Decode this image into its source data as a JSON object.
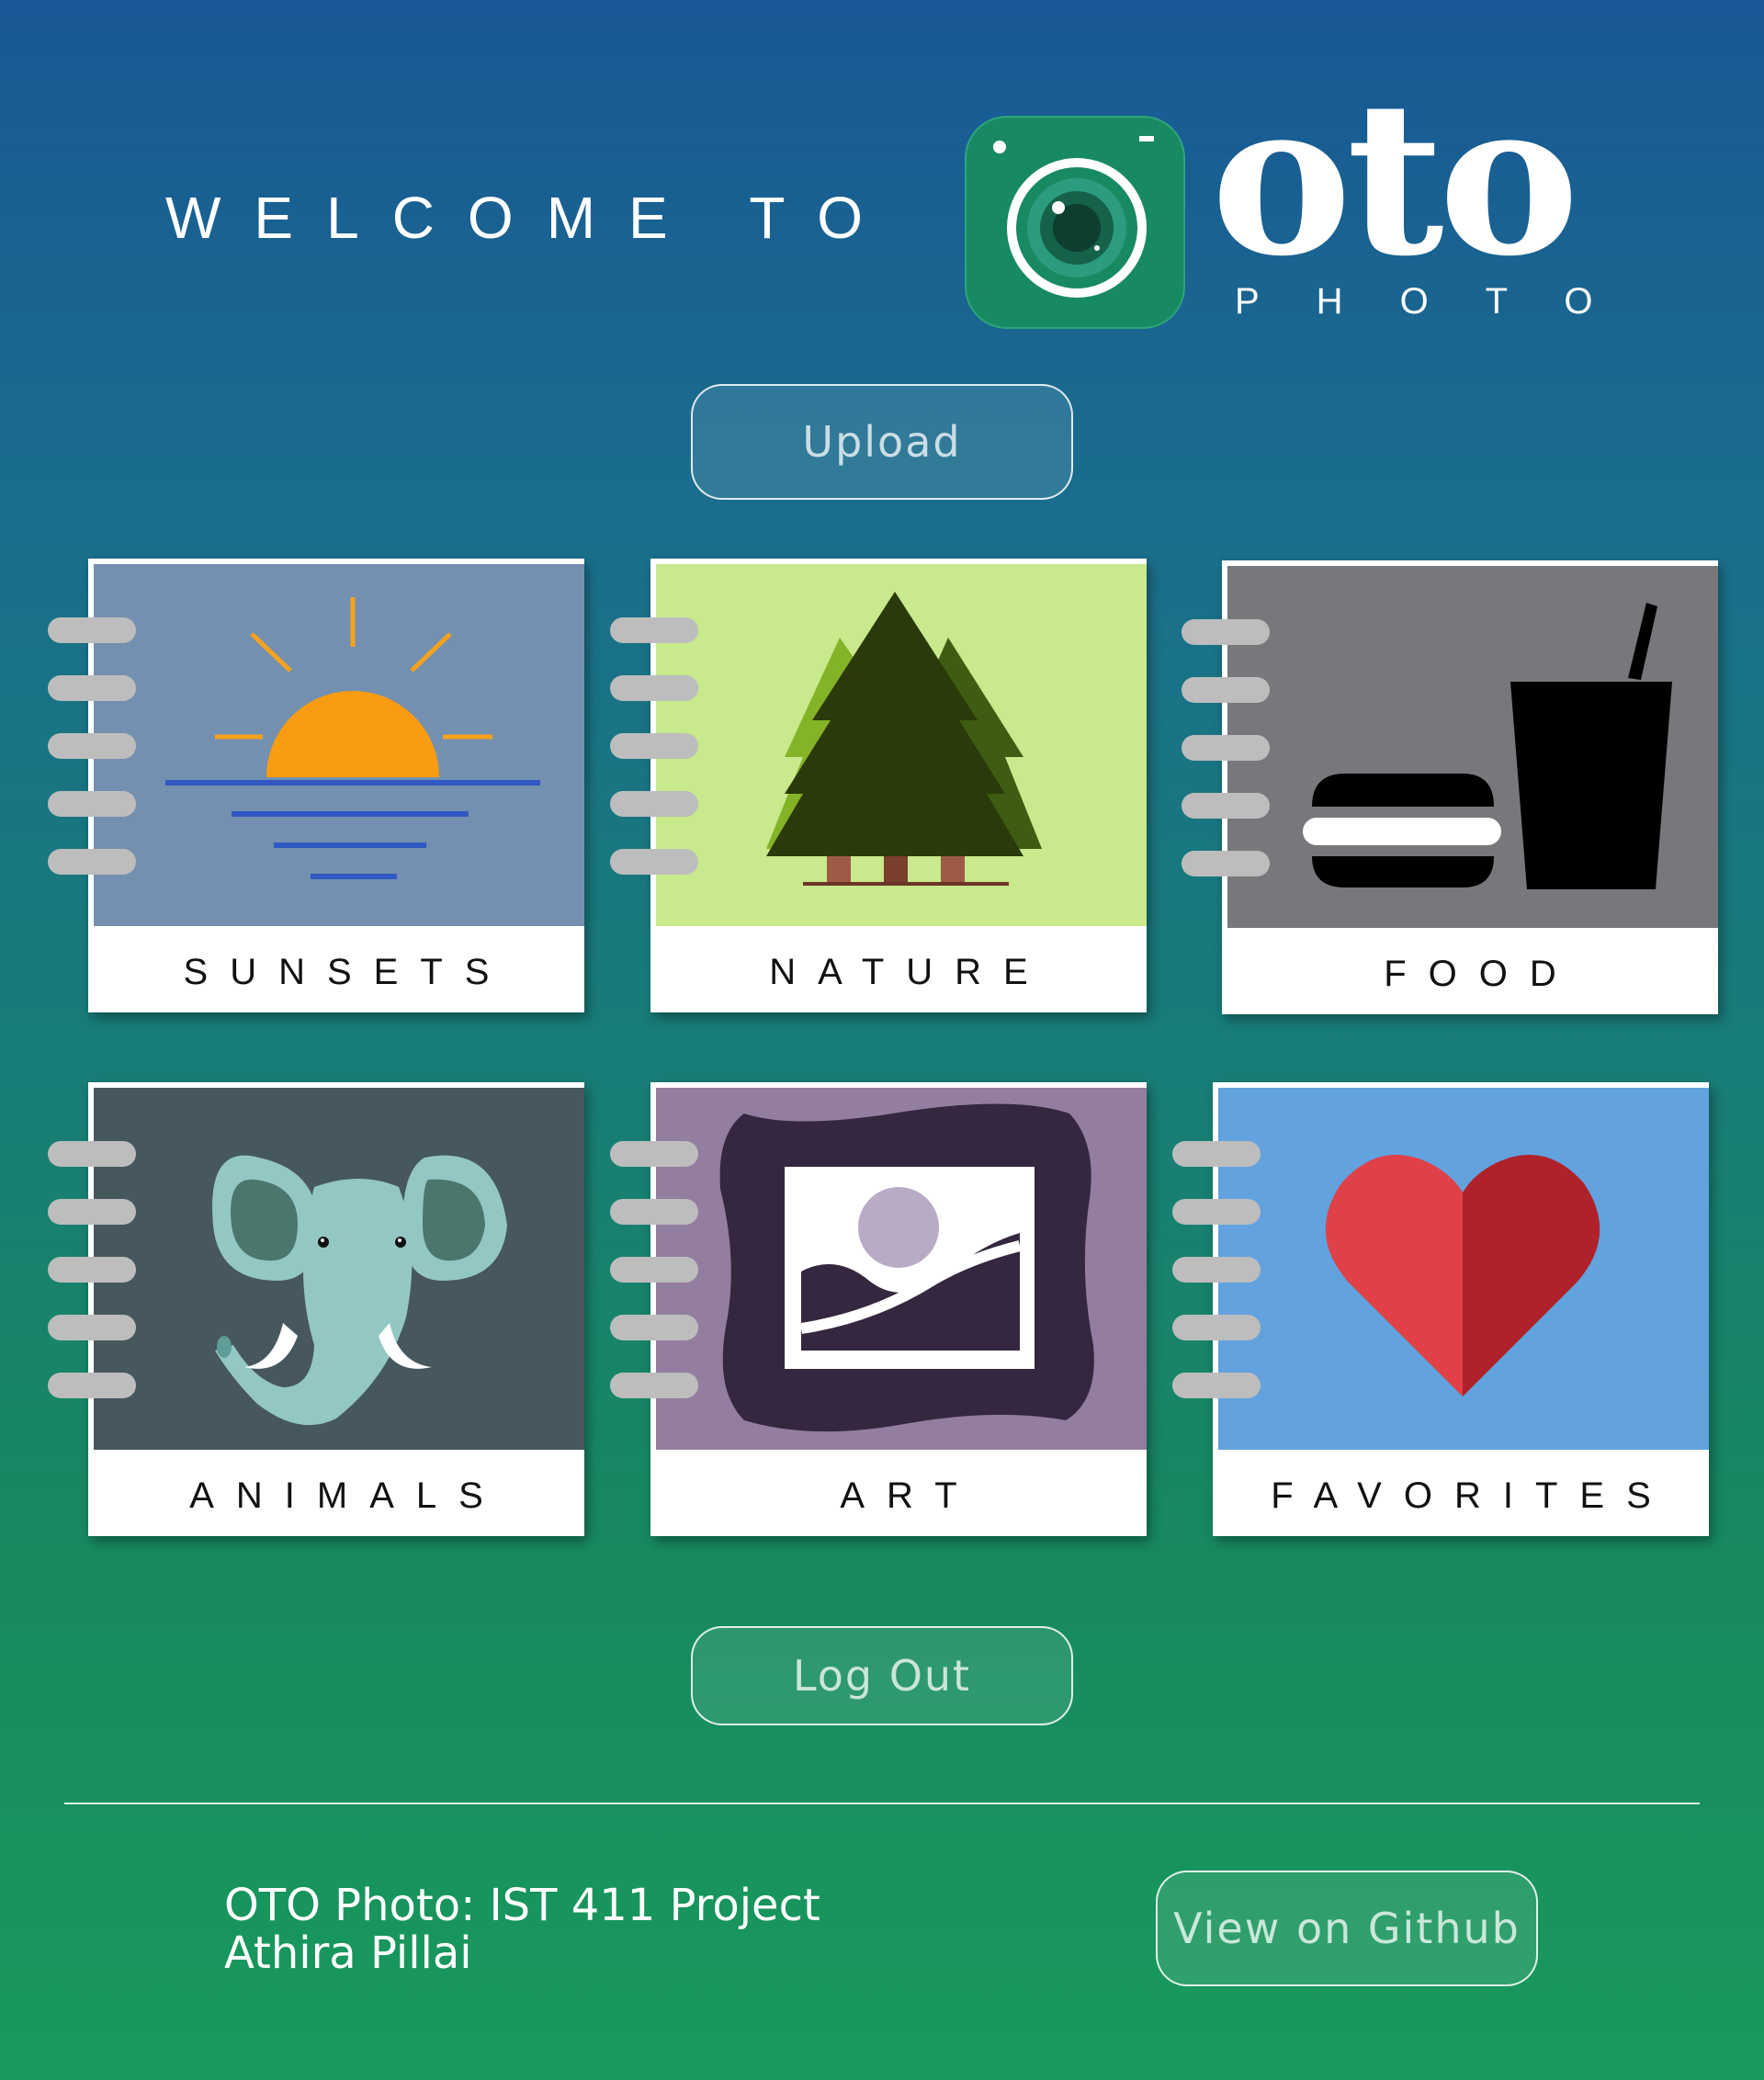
{
  "header": {
    "welcome_text": "WELCOME TO",
    "logo_word": "oto",
    "logo_subtitle": "PHOTO"
  },
  "buttons": {
    "upload_label": "Upload",
    "logout_label": "Log Out",
    "github_label": "View on Github"
  },
  "albums": [
    {
      "label": "SUNSETS",
      "icon": "sunset-icon",
      "bg": "#7490b0"
    },
    {
      "label": "NATURE",
      "icon": "pine-trees-icon",
      "bg": "#c8e98c"
    },
    {
      "label": "FOOD",
      "icon": "burger-and-drink-icon",
      "bg": "#77787c"
    },
    {
      "label": "ANIMALS",
      "icon": "elephant-icon",
      "bg": "#47575e"
    },
    {
      "label": "ART",
      "icon": "framed-picture-icon",
      "bg": "#937ea0"
    },
    {
      "label": "FAVORITES",
      "icon": "heart-icon",
      "bg": "#62a2df"
    }
  ],
  "footer": {
    "line1": "OTO Photo: IST 411 Project",
    "line2": "Athira Pillai"
  },
  "colors": {
    "accent_green": "#188a62",
    "background_top": "#185896",
    "background_bottom": "#199a5c"
  }
}
